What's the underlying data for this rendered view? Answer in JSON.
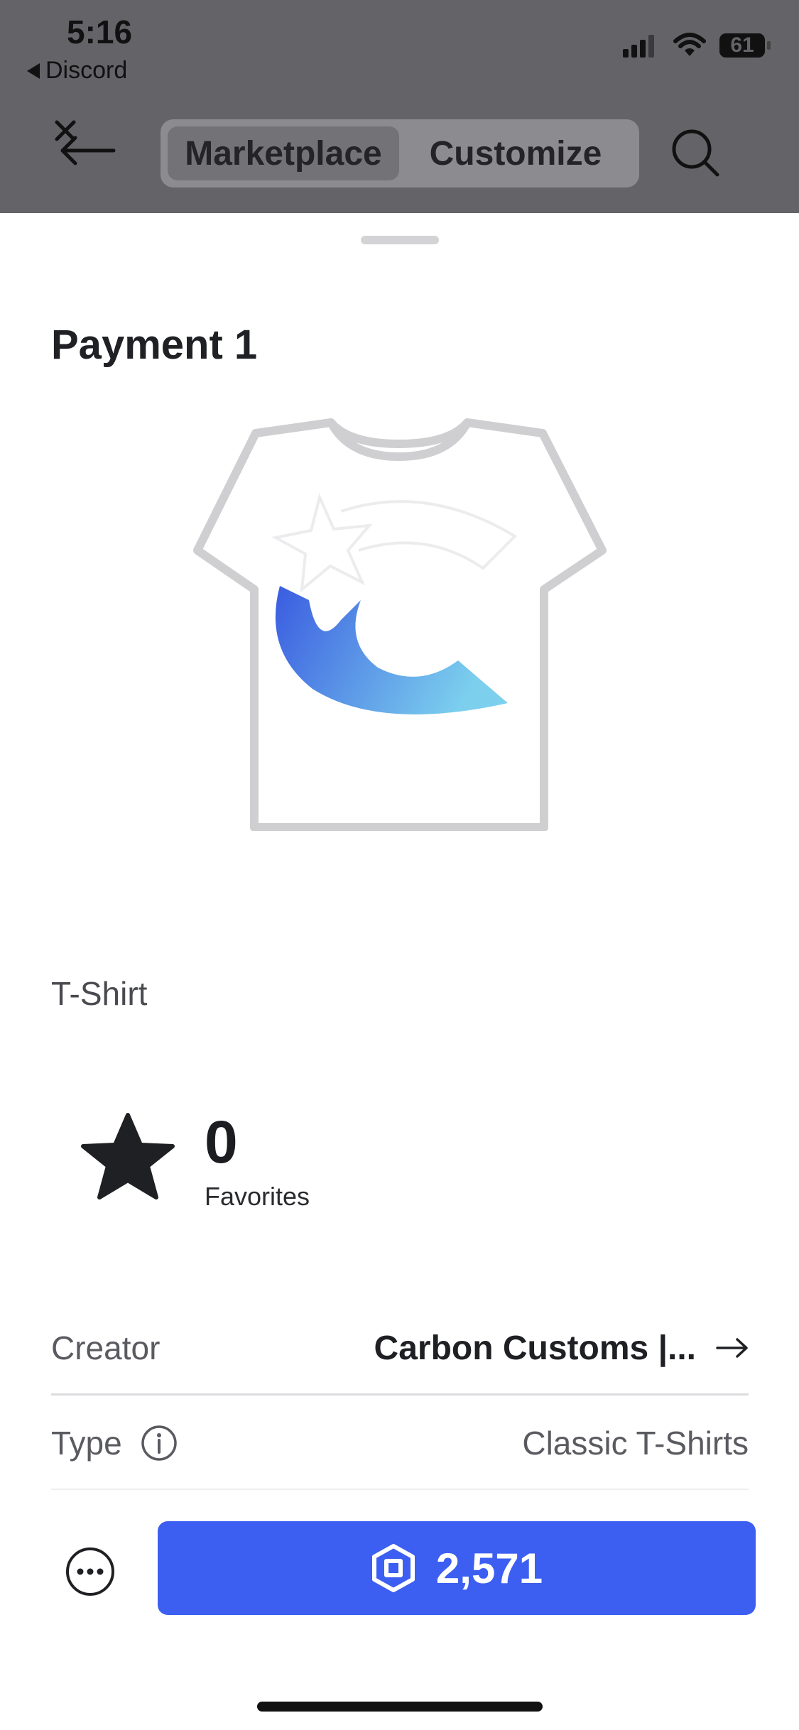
{
  "status_bar": {
    "time": "5:16",
    "back_app": "Discord",
    "battery": "61"
  },
  "nav": {
    "tabs": [
      {
        "label": "Marketplace",
        "active": true
      },
      {
        "label": "Customize",
        "active": false
      }
    ]
  },
  "item": {
    "title": "Payment 1",
    "category": "T-Shirt",
    "favorites_count": "0",
    "favorites_label": "Favorites"
  },
  "details": {
    "creator_label": "Creator",
    "creator_value": "Carbon Customs |...",
    "type_label": "Type",
    "type_value": "Classic T-Shirts"
  },
  "purchase": {
    "price": "2,571",
    "currency_icon": "robux-icon"
  },
  "colors": {
    "accent": "#3c5ff1",
    "header_dim": "#646468"
  }
}
